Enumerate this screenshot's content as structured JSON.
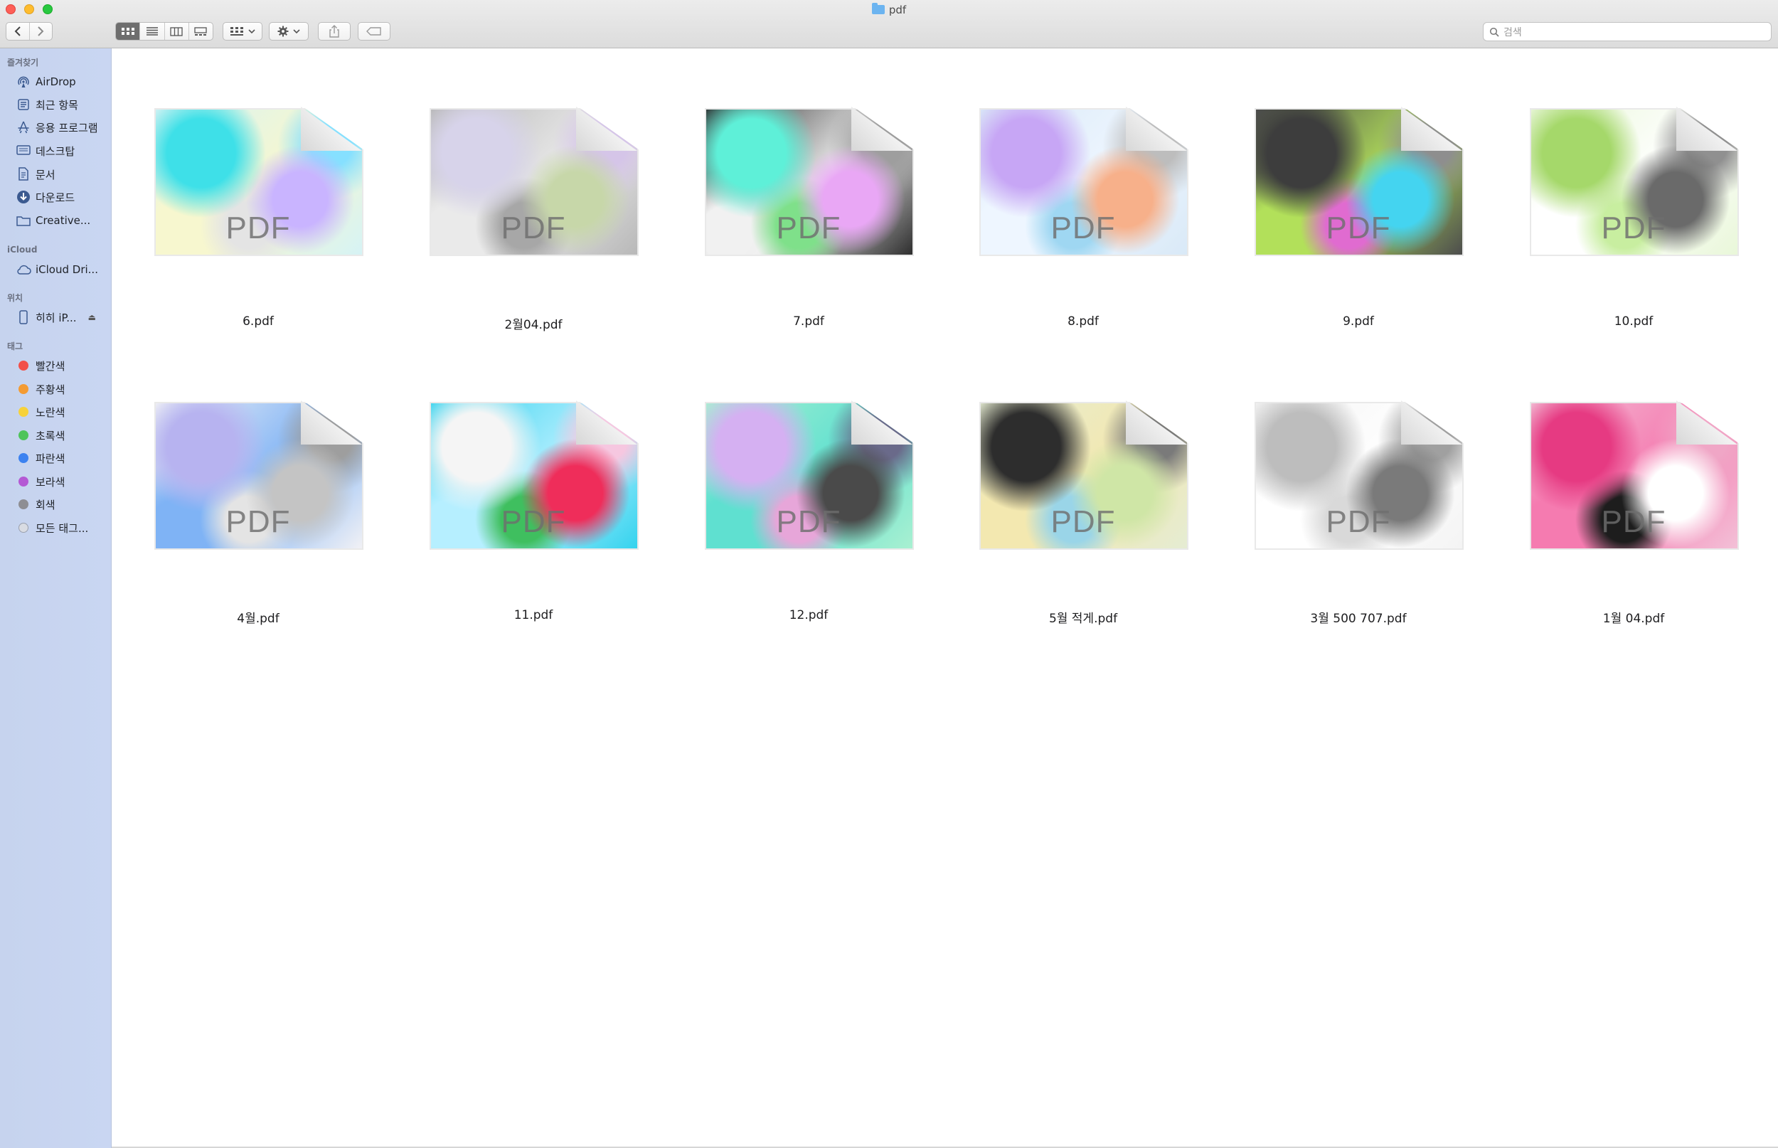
{
  "window": {
    "title": "pdf"
  },
  "toolbar": {
    "search": {
      "placeholder": "검색"
    }
  },
  "sidebar": {
    "sections": {
      "favorites": "즐겨찾기",
      "icloud": "iCloud",
      "locations": "위치",
      "tags": "태그"
    },
    "favorites": [
      {
        "label": "AirDrop",
        "icon": "airdrop-icon"
      },
      {
        "label": "최근 항목",
        "icon": "recents-icon"
      },
      {
        "label": "응용 프로그램",
        "icon": "applications-icon"
      },
      {
        "label": "데스크탑",
        "icon": "desktop-icon"
      },
      {
        "label": "문서",
        "icon": "document-icon"
      },
      {
        "label": "다운로드",
        "icon": "downloads-icon"
      },
      {
        "label": "Creative...",
        "icon": "folder-icon"
      }
    ],
    "icloud": [
      {
        "label": "iCloud Dri...",
        "icon": "cloud-icon"
      }
    ],
    "locations": [
      {
        "label": "히히 iP...",
        "icon": "iphone-icon"
      }
    ],
    "tags": [
      {
        "label": "빨간색",
        "color": "#f2504a"
      },
      {
        "label": "주황색",
        "color": "#f49b32"
      },
      {
        "label": "노란색",
        "color": "#f7d23a"
      },
      {
        "label": "초록색",
        "color": "#4ec45a"
      },
      {
        "label": "파란색",
        "color": "#3c82f0"
      },
      {
        "label": "보라색",
        "color": "#b459d4"
      },
      {
        "label": "회색",
        "color": "#8e8e93"
      },
      {
        "label": "모든 태그...",
        "color": "#d9dce3"
      }
    ]
  },
  "files": [
    {
      "name": "6.pdf",
      "badge": "PDF",
      "colors": [
        "#d6f3f5",
        "#3ee0e8",
        "#c9b4ff",
        "#f7f7cf",
        "#e4e4e4",
        "#86e0ff"
      ]
    },
    {
      "name": "2월04.pdf",
      "badge": "PDF",
      "colors": [
        "#b8b8b8",
        "#d7d3ea",
        "#c7d7a9",
        "#eaeaea",
        "#a7a7a7",
        "#d5c5e8"
      ]
    },
    {
      "name": "7.pdf",
      "badge": "PDF",
      "colors": [
        "#2e2e2e",
        "#5ef0d8",
        "#e9a7f5",
        "#f1f1f1",
        "#7fe08a",
        "#9e9e9e"
      ]
    },
    {
      "name": "8.pdf",
      "badge": "PDF",
      "colors": [
        "#d9e9f7",
        "#c7a6f5",
        "#f7b08a",
        "#eef6ff",
        "#9fd7f2",
        "#bdbdbd"
      ]
    },
    {
      "name": "9.pdf",
      "badge": "PDF",
      "colors": [
        "#4d4d4d",
        "#3d3d3d",
        "#44d4f0",
        "#b2e05a",
        "#e06bd0",
        "#8e8e8e"
      ]
    },
    {
      "name": "10.pdf",
      "badge": "PDF",
      "colors": [
        "#e9f7d9",
        "#a5d86a",
        "#6a6a6a",
        "#ffffff",
        "#c8eea0",
        "#909090"
      ]
    },
    {
      "name": "4월.pdf",
      "badge": "PDF",
      "colors": [
        "#f1f1f5",
        "#b7b3f0",
        "#c4c4c4",
        "#7fb3f5",
        "#e4e4e4",
        "#9e9e9e"
      ]
    },
    {
      "name": "11.pdf",
      "badge": "PDF",
      "colors": [
        "#35d3ee",
        "#f5f5f5",
        "#ef2d5a",
        "#b6efff",
        "#3fbf5f",
        "#f6c7e0"
      ]
    },
    {
      "name": "12.pdf",
      "badge": "PDF",
      "colors": [
        "#a9f0d1",
        "#d5b0f2",
        "#4a4a4a",
        "#5fe0d0",
        "#e7a6d9",
        "#6a6a8a"
      ]
    },
    {
      "name": "5월 적게.pdf",
      "badge": "PDF",
      "colors": [
        "#e5ecd3",
        "#2d2d2d",
        "#cfe6a6",
        "#f3e8b0",
        "#9ad5e8",
        "#7a7a7a"
      ]
    },
    {
      "name": "3월 500 707.pdf",
      "badge": "PDF",
      "colors": [
        "#f4f4f4",
        "#bdbdbd",
        "#7a7a7a",
        "#ffffff",
        "#d9d9d9",
        "#a0a0a0"
      ]
    },
    {
      "name": "1월 04.pdf",
      "badge": "PDF",
      "colors": [
        "#f3c0d7",
        "#e63a82",
        "#ffffff",
        "#f57bb0",
        "#1d1d1d",
        "#f0a6c6"
      ]
    }
  ]
}
